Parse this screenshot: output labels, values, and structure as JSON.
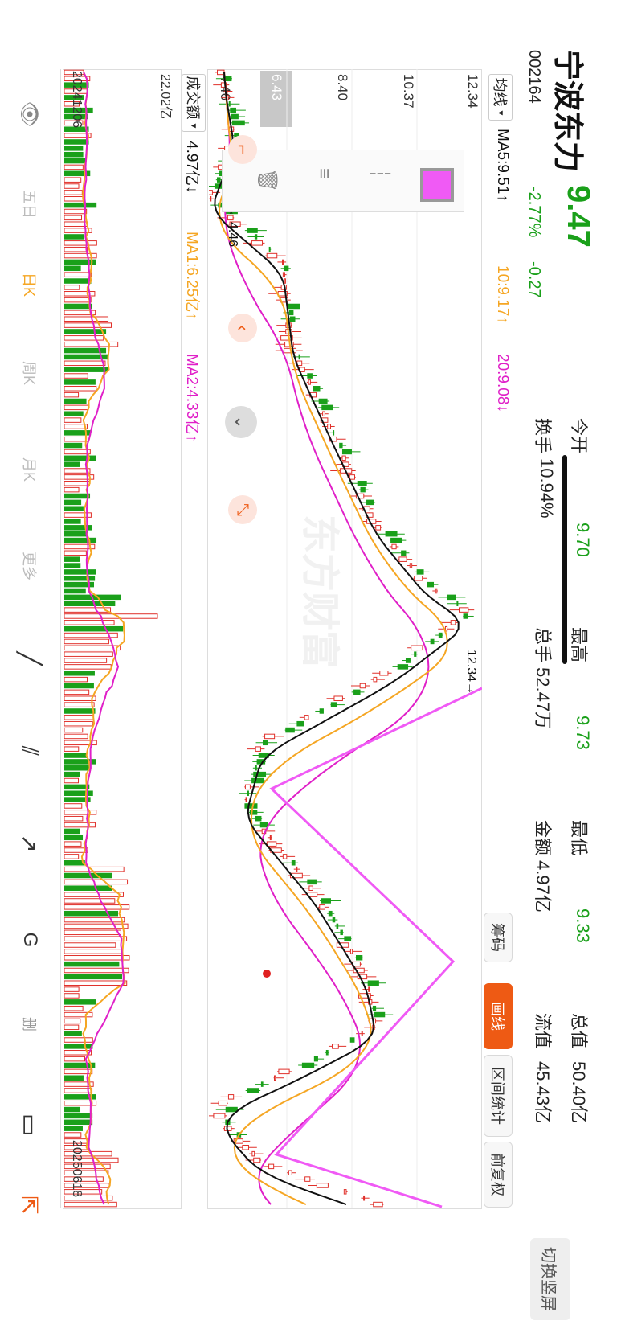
{
  "header": {
    "name": "宁波东力",
    "code": "002164",
    "price": "9.47",
    "change_pct": "-2.77%",
    "change": "-0.27",
    "switch_label": "切换竖屏"
  },
  "stats": [
    {
      "label": "今开",
      "value": "9.70",
      "color": "#1aa01a"
    },
    {
      "label": "最高",
      "value": "9.73",
      "color": "#1aa01a"
    },
    {
      "label": "最低",
      "value": "9.33",
      "color": "#1aa01a"
    },
    {
      "label": "总值",
      "value": "50.40亿",
      "color": "#222222"
    },
    {
      "label": "换手",
      "value": "10.94%",
      "color": "#222222"
    },
    {
      "label": "总手",
      "value": "52.47万",
      "color": "#222222"
    },
    {
      "label": "金额",
      "value": "4.97亿",
      "color": "#222222"
    },
    {
      "label": "流值",
      "value": "45.43亿",
      "color": "#222222"
    }
  ],
  "ma_bar": {
    "selector": "均线",
    "ma5": "MA5:9.51↑",
    "ma10": "10:9.17↑",
    "ma20": "20:9.08↓",
    "colors": {
      "ma5": "#111111",
      "ma10": "#f5a623",
      "ma20": "#e020c8"
    }
  },
  "price_axis": [
    "12.34",
    "10.37",
    "8.40",
    "6.43",
    "4.46"
  ],
  "annotations": {
    "high": "12.34→",
    "low": "←4.46"
  },
  "vol_bar": {
    "selector": "成交额",
    "value": "4.97亿↓",
    "ma1": "MA1:6.25亿↑",
    "ma2": "MA2:4.33亿↑",
    "max": "22.02亿"
  },
  "dates": {
    "start": "20241206",
    "end": "20250618"
  },
  "right_buttons": [
    "筹码",
    "画线",
    "区间统计",
    "前复权"
  ],
  "watermark": "东方财富",
  "tools": [
    {
      "name": "eye-icon",
      "glyph": "👁"
    },
    {
      "name": "five-day-button",
      "glyph": "五日"
    },
    {
      "name": "day-k-button",
      "glyph": "日K"
    },
    {
      "name": "week-k-button",
      "glyph": "周K"
    },
    {
      "name": "month-k-button",
      "glyph": "月K"
    },
    {
      "name": "more-button",
      "glyph": "更多"
    },
    {
      "name": "line-tool-icon",
      "glyph": "╱"
    },
    {
      "name": "parallel-line-icon",
      "glyph": "⫽"
    },
    {
      "name": "arrow-line-icon",
      "glyph": "↗"
    },
    {
      "name": "fib-tool-icon",
      "glyph": "G"
    },
    {
      "name": "delete-all-icon",
      "glyph": "删"
    },
    {
      "name": "rect-tool-icon",
      "glyph": "▭"
    },
    {
      "name": "exit-icon",
      "glyph": "⇱"
    }
  ],
  "chart_data": {
    "type": "candlestick",
    "y_axis_ticks": [
      12.34,
      10.37,
      8.4,
      6.43,
      4.46
    ],
    "x_range": [
      "20241206",
      "20250618"
    ],
    "high": 12.34,
    "low": 4.46,
    "last_close": 9.47,
    "volume_max_label": "22.02亿"
  }
}
